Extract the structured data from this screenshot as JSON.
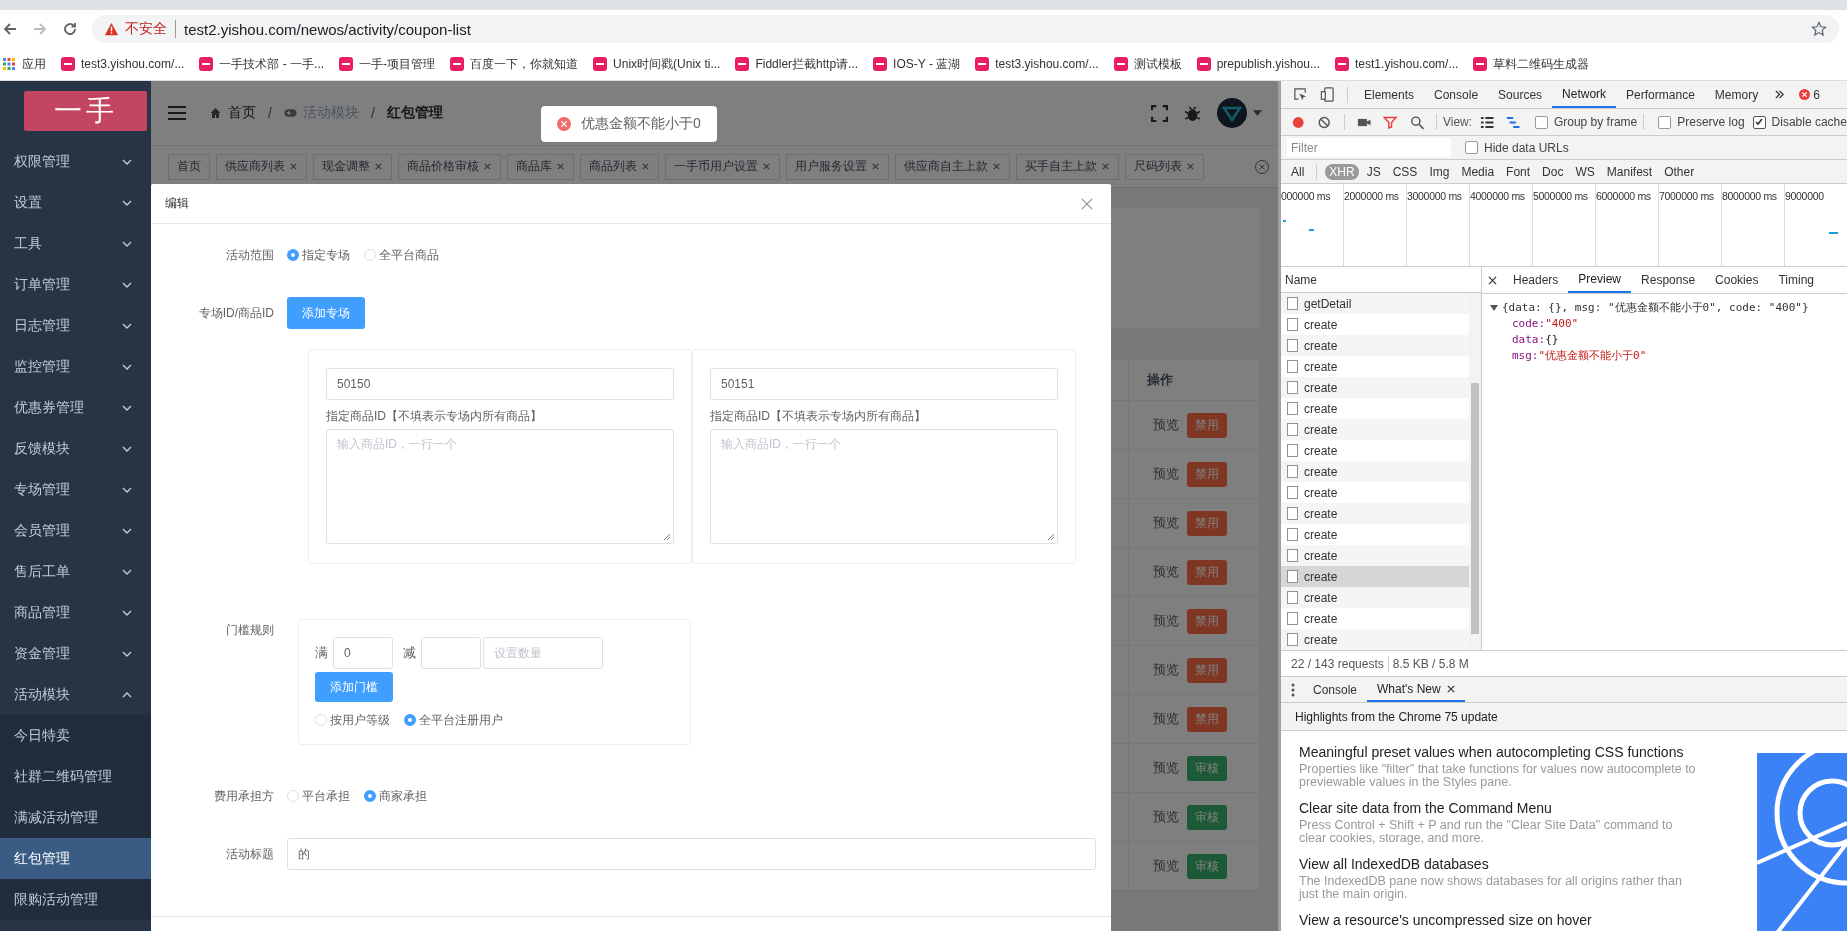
{
  "browser": {
    "security": "不安全",
    "url": "test2.yishou.com/newos/activity/coupon-list",
    "bookmarks": [
      {
        "label": "应用",
        "kind": "apps"
      },
      {
        "label": "test3.yishou.com/...",
        "kind": "site"
      },
      {
        "label": "一手技术部 - 一手...",
        "kind": "site"
      },
      {
        "label": "一手-项目管理",
        "kind": "site"
      },
      {
        "label": "百度一下，你就知道",
        "kind": "site"
      },
      {
        "label": "Unix时间戳(Unix ti...",
        "kind": "site"
      },
      {
        "label": "Fiddler拦截http请...",
        "kind": "site"
      },
      {
        "label": "IOS-Y - 蓝湖",
        "kind": "site"
      },
      {
        "label": "test3.yishou.com/...",
        "kind": "site"
      },
      {
        "label": "测试模板",
        "kind": "site"
      },
      {
        "label": "prepublish.yishou...",
        "kind": "site"
      },
      {
        "label": "test1.yishou.com/...",
        "kind": "site"
      },
      {
        "label": "草料二维码生成器",
        "kind": "site"
      }
    ]
  },
  "app": {
    "logo": "一手",
    "menu": [
      {
        "label": "权限管理",
        "expanded": false
      },
      {
        "label": "设置",
        "expanded": false
      },
      {
        "label": "工具",
        "expanded": false
      },
      {
        "label": "订单管理",
        "expanded": false
      },
      {
        "label": "日志管理",
        "expanded": false
      },
      {
        "label": "监控管理",
        "expanded": false
      },
      {
        "label": "优惠券管理",
        "expanded": false
      },
      {
        "label": "反馈模块",
        "expanded": false
      },
      {
        "label": "专场管理",
        "expanded": false
      },
      {
        "label": "会员管理",
        "expanded": false
      },
      {
        "label": "售后工单",
        "expanded": false
      },
      {
        "label": "商品管理",
        "expanded": false
      },
      {
        "label": "资金管理",
        "expanded": false
      },
      {
        "label": "活动模块",
        "expanded": true,
        "children": [
          {
            "label": "今日特卖",
            "selected": false
          },
          {
            "label": "社群二维码管理",
            "selected": false
          },
          {
            "label": "满减活动管理",
            "selected": false
          },
          {
            "label": "红包管理",
            "selected": true
          },
          {
            "label": "限购活动管理",
            "selected": false
          }
        ]
      }
    ],
    "breadcrumb": [
      "首页",
      "活动模块",
      "红包管理"
    ],
    "breadcrumb_separator": "/",
    "tags": [
      {
        "label": "首页",
        "closable": false
      },
      {
        "label": "供应商列表",
        "closable": true
      },
      {
        "label": "现金调整",
        "closable": true
      },
      {
        "label": "商品价格审核",
        "closable": true
      },
      {
        "label": "商品库",
        "closable": true
      },
      {
        "label": "商品列表",
        "closable": true
      },
      {
        "label": "一手币用户设置",
        "closable": true
      },
      {
        "label": "用户服务设置",
        "closable": true
      },
      {
        "label": "供应商自主上款",
        "closable": true
      },
      {
        "label": "买手自主上款",
        "closable": true
      },
      {
        "label": "尺码列表",
        "closable": true
      }
    ],
    "table": {
      "columns": [
        "操作"
      ],
      "rows": [
        {
          "preview": "预览",
          "action": {
            "kind": "disable",
            "label": "禁用"
          }
        },
        {
          "preview": "预览",
          "action": {
            "kind": "disable",
            "label": "禁用"
          }
        },
        {
          "preview": "预览",
          "action": {
            "kind": "disable",
            "label": "禁用"
          }
        },
        {
          "preview": "预览",
          "action": {
            "kind": "disable",
            "label": "禁用"
          }
        },
        {
          "preview": "预览",
          "action": {
            "kind": "disable",
            "label": "禁用"
          }
        },
        {
          "preview": "预览",
          "action": {
            "kind": "disable",
            "label": "禁用"
          }
        },
        {
          "preview": "预览",
          "action": {
            "kind": "disable",
            "label": "禁用"
          }
        },
        {
          "preview": "预览",
          "action": {
            "kind": "review",
            "label": "审核"
          }
        },
        {
          "preview": "预览",
          "action": {
            "kind": "review",
            "label": "审核"
          }
        },
        {
          "preview": "预览",
          "action": {
            "kind": "review",
            "label": "审核"
          }
        }
      ]
    },
    "toast": {
      "kind": "error",
      "message": "优惠金额不能小于0"
    },
    "dialog": {
      "title": "编辑",
      "fields": [
        {
          "kind": "radio",
          "label": "活动范围",
          "options": [
            {
              "label": "指定专场",
              "selected": true
            },
            {
              "label": "全平台商品",
              "selected": false
            }
          ]
        },
        {
          "kind": "venues",
          "label": "专场ID/商品ID",
          "button": "添加专场",
          "cards": [
            {
              "venue_id": "50150",
              "goods_label": "指定商品ID【不填表示专场内所有商品】",
              "goods_placeholder": "输入商品ID，一行一个"
            },
            {
              "venue_id": "50151",
              "goods_label": "指定商品ID【不填表示专场内所有商品】",
              "goods_placeholder": "输入商品ID，一行一个"
            }
          ]
        },
        {
          "kind": "threshold",
          "label": "门槛规则",
          "full_prefix": "满",
          "full_value": "0",
          "minus_prefix": "减",
          "amount_placeholder": "设置数量",
          "button": "添加门槛",
          "options": [
            {
              "label": "按用户等级",
              "selected": false
            },
            {
              "label": "全平台注册用户",
              "selected": true
            }
          ]
        },
        {
          "kind": "radio",
          "label": "费用承担方",
          "options": [
            {
              "label": "平台承担",
              "selected": false
            },
            {
              "label": "商家承担",
              "selected": true
            }
          ]
        },
        {
          "kind": "text",
          "label": "活动标题",
          "value": "的"
        }
      ]
    }
  },
  "devtools": {
    "tabs": [
      {
        "label": "Elements",
        "selected": false
      },
      {
        "label": "Console",
        "selected": false
      },
      {
        "label": "Sources",
        "selected": false
      },
      {
        "label": "Network",
        "selected": true
      },
      {
        "label": "Performance",
        "selected": false
      },
      {
        "label": "Memory",
        "selected": false
      }
    ],
    "error_count": "6",
    "view_label": "View:",
    "options": [
      {
        "label": "Group by frame",
        "checked": false
      },
      {
        "label": "Preserve log",
        "checked": false
      },
      {
        "label": "Disable cache",
        "checked": true
      }
    ],
    "filter_placeholder": "Filter",
    "hide_data_urls": {
      "label": "Hide data URLs",
      "checked": false
    },
    "types": [
      {
        "label": "All",
        "selected": false
      },
      {
        "label": "XHR",
        "selected": true
      },
      {
        "label": "JS",
        "selected": false
      },
      {
        "label": "CSS",
        "selected": false
      },
      {
        "label": "Img",
        "selected": false
      },
      {
        "label": "Media",
        "selected": false
      },
      {
        "label": "Font",
        "selected": false
      },
      {
        "label": "Doc",
        "selected": false
      },
      {
        "label": "WS",
        "selected": false
      },
      {
        "label": "Manifest",
        "selected": false
      },
      {
        "label": "Other",
        "selected": false
      }
    ],
    "timeline_ticks": [
      "000000 ms",
      "2000000 ms",
      "3000000 ms",
      "4000000 ms",
      "5000000 ms",
      "6000000 ms",
      "7000000 ms",
      "8000000 ms",
      "9000000"
    ],
    "name_column": "Name",
    "requests": [
      {
        "name": "getDetail",
        "selected": false
      },
      {
        "name": "create",
        "selected": false
      },
      {
        "name": "create",
        "selected": false
      },
      {
        "name": "create",
        "selected": false
      },
      {
        "name": "create",
        "selected": false
      },
      {
        "name": "create",
        "selected": false
      },
      {
        "name": "create",
        "selected": false
      },
      {
        "name": "create",
        "selected": false
      },
      {
        "name": "create",
        "selected": false
      },
      {
        "name": "create",
        "selected": false
      },
      {
        "name": "create",
        "selected": false
      },
      {
        "name": "create",
        "selected": false
      },
      {
        "name": "create",
        "selected": false
      },
      {
        "name": "create",
        "selected": true
      },
      {
        "name": "create",
        "selected": false
      },
      {
        "name": "create",
        "selected": false
      },
      {
        "name": "create",
        "selected": false
      }
    ],
    "status": [
      "22 / 143 requests",
      "8.5 KB / 5.8 M"
    ],
    "detail_tabs": [
      {
        "label": "Headers",
        "selected": false
      },
      {
        "label": "Preview",
        "selected": true
      },
      {
        "label": "Response",
        "selected": false
      },
      {
        "label": "Cookies",
        "selected": false
      },
      {
        "label": "Timing",
        "selected": false
      }
    ],
    "preview": {
      "summary": "{data: {}, msg: \"优惠金额不能小于0\", code: \"400\"}",
      "properties": [
        {
          "key": "code:",
          "value": "\"400\"",
          "kind": "string"
        },
        {
          "key": "data:",
          "value": "{}",
          "kind": "object"
        },
        {
          "key": "msg:",
          "value": "\"优惠金额不能小于0\"",
          "kind": "string"
        }
      ]
    },
    "drawer_tabs": [
      {
        "label": "Console",
        "selected": false,
        "closable": false
      },
      {
        "label": "What's New",
        "selected": true,
        "closable": true
      }
    ],
    "headline": "Highlights from the Chrome 75 update",
    "news": [
      {
        "title": "Meaningful preset values when autocompleting CSS functions",
        "description": "Properties like \"filter\" that take functions for values now autocomplete to previewable values in the Styles pane."
      },
      {
        "title": "Clear site data from the Command Menu",
        "description": "Press Control + Shift + P and run the \"Clear Site Data\" command to clear cookies, storage, and more."
      },
      {
        "title": "View all IndexedDB databases",
        "description": "The IndexedDB pane now shows databases for all origins rather than just the main origin."
      },
      {
        "title": "View a resource's uncompressed size on hover"
      }
    ]
  }
}
